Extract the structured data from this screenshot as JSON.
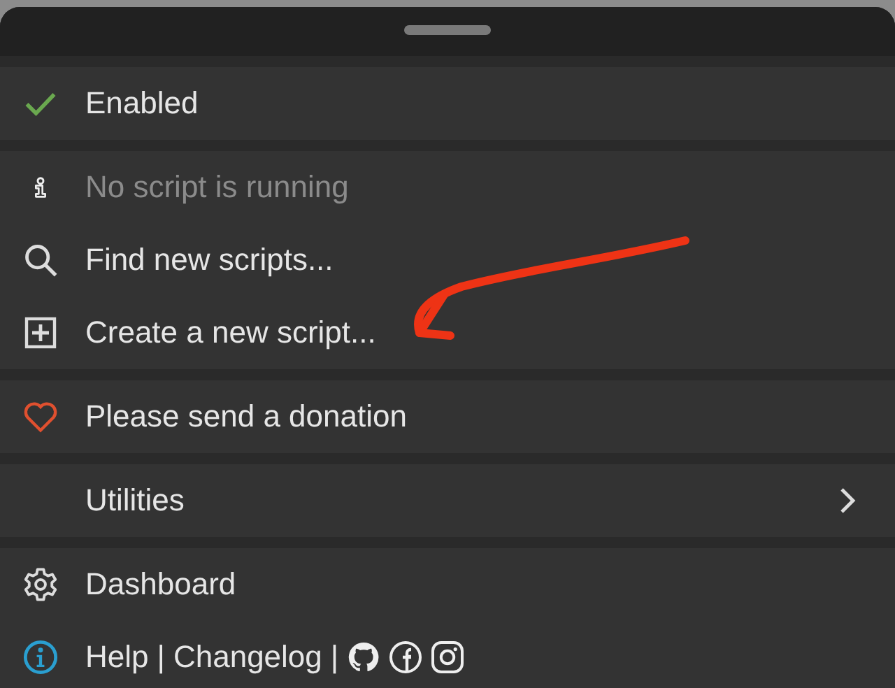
{
  "sections": [
    {
      "items": [
        {
          "kind": "toggle",
          "label": "Enabled",
          "checked": true,
          "disabled": false
        }
      ]
    },
    {
      "items": [
        {
          "kind": "action",
          "label": "No script is running",
          "disabled": true
        },
        {
          "kind": "action",
          "label": "Find new scripts...",
          "disabled": false
        },
        {
          "kind": "action",
          "label": "Create a new script...",
          "disabled": false
        }
      ]
    },
    {
      "items": [
        {
          "kind": "action",
          "label": "Please send a donation",
          "disabled": false
        }
      ]
    },
    {
      "items": [
        {
          "kind": "submenu",
          "label": "Utilities",
          "disabled": false
        }
      ]
    },
    {
      "items": [
        {
          "kind": "action",
          "label": "Dashboard",
          "disabled": false
        },
        {
          "kind": "links",
          "parts": [
            "Help",
            "|",
            "Changelog",
            "|"
          ]
        }
      ]
    }
  ]
}
